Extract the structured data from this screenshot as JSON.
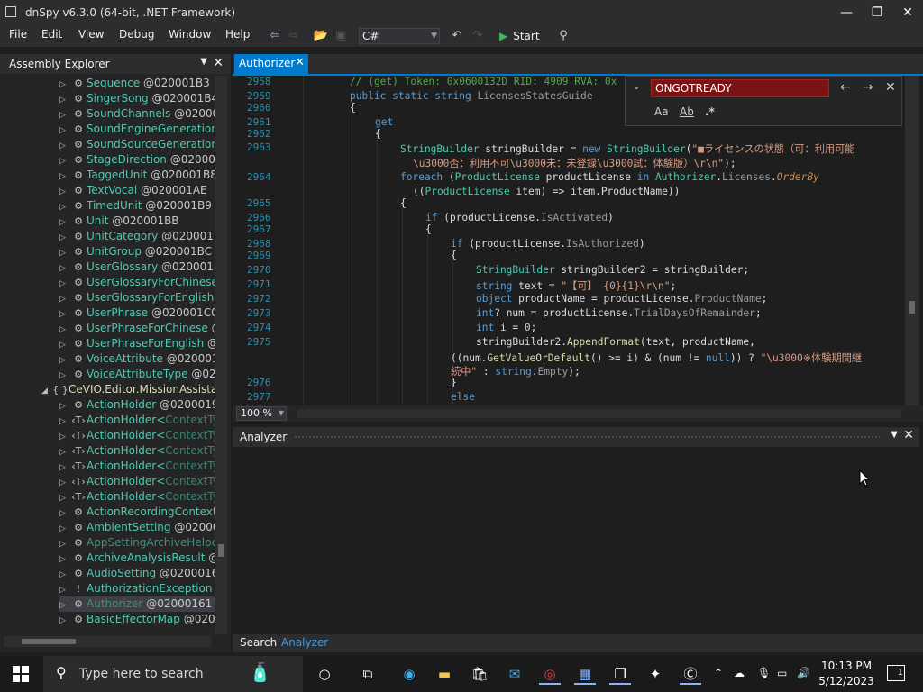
{
  "window": {
    "title": "dnSpy v6.3.0 (64-bit, .NET Framework)"
  },
  "menu": [
    "File",
    "Edit",
    "View",
    "Debug",
    "Window",
    "Help"
  ],
  "toolbar": {
    "language": "C#",
    "start_label": "Start"
  },
  "assembly_explorer": {
    "title": "Assembly Explorer",
    "nodes": [
      {
        "name": "Sequence",
        "token": "@020001B3"
      },
      {
        "name": "SingerSong",
        "token": "@020001B4"
      },
      {
        "name": "SoundChannels",
        "token": "@020001E"
      },
      {
        "name": "SoundEngineGeneration",
        "token": "@"
      },
      {
        "name": "SoundSourceGeneration",
        "token": "@"
      },
      {
        "name": "StageDirection",
        "token": "@020001B7"
      },
      {
        "name": "TaggedUnit",
        "token": "@020001B8"
      },
      {
        "name": "TextVocal",
        "token": "@020001AE"
      },
      {
        "name": "TimedUnit",
        "token": "@020001B9"
      },
      {
        "name": "Unit",
        "token": "@020001BB"
      },
      {
        "name": "UnitCategory",
        "token": "@020001BA"
      },
      {
        "name": "UnitGroup",
        "token": "@020001BC"
      },
      {
        "name": "UserGlossary",
        "token": "@020001BD"
      },
      {
        "name": "UserGlossaryForChinese",
        "token": "@"
      },
      {
        "name": "UserGlossaryForEnglish",
        "token": "@"
      },
      {
        "name": "UserPhrase",
        "token": "@020001C0"
      },
      {
        "name": "UserPhraseForChinese",
        "token": "@0"
      },
      {
        "name": "UserPhraseForEnglish",
        "token": "@0"
      },
      {
        "name": "VoiceAttribute",
        "token": "@020001C4"
      },
      {
        "name": "VoiceAttributeType",
        "token": "@0200"
      }
    ],
    "namespace": "CeVIO.Editor.MissionAssistan",
    "ns_nodes": [
      {
        "name": "ActionHolder",
        "token": "@02000192"
      },
      {
        "name": "ActionHolder<",
        "token": "ContextTyp"
      },
      {
        "name": "ActionHolder<",
        "token": "ContextTyp"
      },
      {
        "name": "ActionHolder<",
        "token": "ContextTyp"
      },
      {
        "name": "ActionHolder<",
        "token": "ContextTyp"
      },
      {
        "name": "ActionHolder<",
        "token": "ContextTyp"
      },
      {
        "name": "ActionHolder<",
        "token": "ContextTyp"
      },
      {
        "name": "ActionRecordingContext",
        "token": ""
      },
      {
        "name": "AmbientSetting",
        "token": "@0200016"
      },
      {
        "name": "AppSettingArchiveHelper",
        "token": ""
      },
      {
        "name": "ArchiveAnalysisResult",
        "token": "@0"
      },
      {
        "name": "AudioSetting",
        "token": "@0200016E"
      },
      {
        "name": "AuthorizationException",
        "token": "@"
      },
      {
        "name": "Authorizer",
        "token": "@02000161"
      },
      {
        "name": "BasicEffectorMap",
        "token": "@02000"
      }
    ]
  },
  "editor": {
    "tab": "Authorizer",
    "zoom": "100 %",
    "find_text": "ONGOTREADY",
    "find_options": [
      "Aa",
      "Ab",
      ".*"
    ],
    "lines": {
      "l2958": "2958",
      "l2959": "2959",
      "l2960": "2960",
      "l2961": "2961",
      "l2962": "2962",
      "l2963": "2963",
      "l2964": "2964",
      "l2965": "2965",
      "l2966": "2966",
      "l2967": "2967",
      "l2968": "2968",
      "l2969": "2969",
      "l2970": "2970",
      "l2971": "2971",
      "l2972": "2972",
      "l2973": "2973",
      "l2974": "2974",
      "l2975": "2975",
      "l2976": "2976",
      "l2977": "2977"
    },
    "code": {
      "c2958": "// (get) Token: 0x0600132D RID: 4909 RVA: 0x",
      "c2959_kw": "public static string",
      "c2959_pr": " LicensesStatesGuide",
      "c2960": "{",
      "c2961": "get",
      "c2962": "{",
      "c2963_ty": "StringBuilder",
      "c2963_a": " stringBuilder = ",
      "c2963_kw": "new",
      "c2963_ty2": " StringBuilder",
      "c2963_b": "(",
      "c2963_st": "\"■ライセンスの状態（可：利用可能",
      "c2963_st2": "\\u3000否：利用不可\\u3000未：未登録\\u3000試：体験版）\\r\\n\"",
      "c2963_end": ");",
      "c2964_kw": "foreach",
      "c2964_a": " (",
      "c2964_ty": "ProductLicense",
      "c2964_b": " productLicense ",
      "c2964_kw2": "in",
      "c2964_ty2": " Authorizer",
      "c2964_c": ".",
      "c2964_pr": "Licenses",
      "c2964_d": ".",
      "c2964_me": "OrderBy",
      "c2964_e": "((",
      "c2964_ty3": "ProductLicense",
      "c2964_f": " item) => item.ProductName))",
      "c2965": "{",
      "c2966_kw": "if",
      "c2966_a": " (productLicense.",
      "c2966_pr": "IsActivated",
      "c2966_b": ")",
      "c2967": "{",
      "c2968_kw": "if",
      "c2968_a": " (productLicense.",
      "c2968_pr": "IsAuthorized",
      "c2968_b": ")",
      "c2969": "{",
      "c2970_ty": "StringBuilder",
      "c2970_a": " stringBuilder2 = stringBuilder;",
      "c2971_kw": "string",
      "c2971_a": " text = ",
      "c2971_st": "\"【可】 {0}{1}\\r\\n\"",
      "c2971_b": ";",
      "c2972_kw": "object",
      "c2972_a": " productName = productLicense.",
      "c2972_pr": "ProductName",
      "c2972_b": ";",
      "c2973_kw": "int",
      "c2973_a": "? num = productLicense.",
      "c2973_pr": "TrialDaysOfRemainder",
      "c2973_b": ";",
      "c2974_kw": "int",
      "c2974_a": " i = 0;",
      "c2975_a": "stringBuilder2.",
      "c2975_me": "AppendFormat",
      "c2975_b": "(text, productName,",
      "c2975_c": "((num.",
      "c2975_me2": "GetValueOrDefault",
      "c2975_d": "() >= i) & (num != ",
      "c2975_kw": "null",
      "c2975_e": ")) ? ",
      "c2975_st": "\"\\u3000※体験期間継",
      "c2975_st2": "続中\"",
      "c2975_f": " : ",
      "c2975_kw2": "string",
      "c2975_g": ".",
      "c2975_pr": "Empty",
      "c2975_h": ");",
      "c2976": "}",
      "c2977": "else"
    }
  },
  "analyzer": {
    "title": "Analyzer"
  },
  "bottom_tabs": {
    "search": "Search",
    "analyzer": "Analyzer"
  },
  "taskbar": {
    "search_placeholder": "Type here to search",
    "time": "10:13 PM",
    "date": "5/12/2023",
    "notifications": "1"
  }
}
